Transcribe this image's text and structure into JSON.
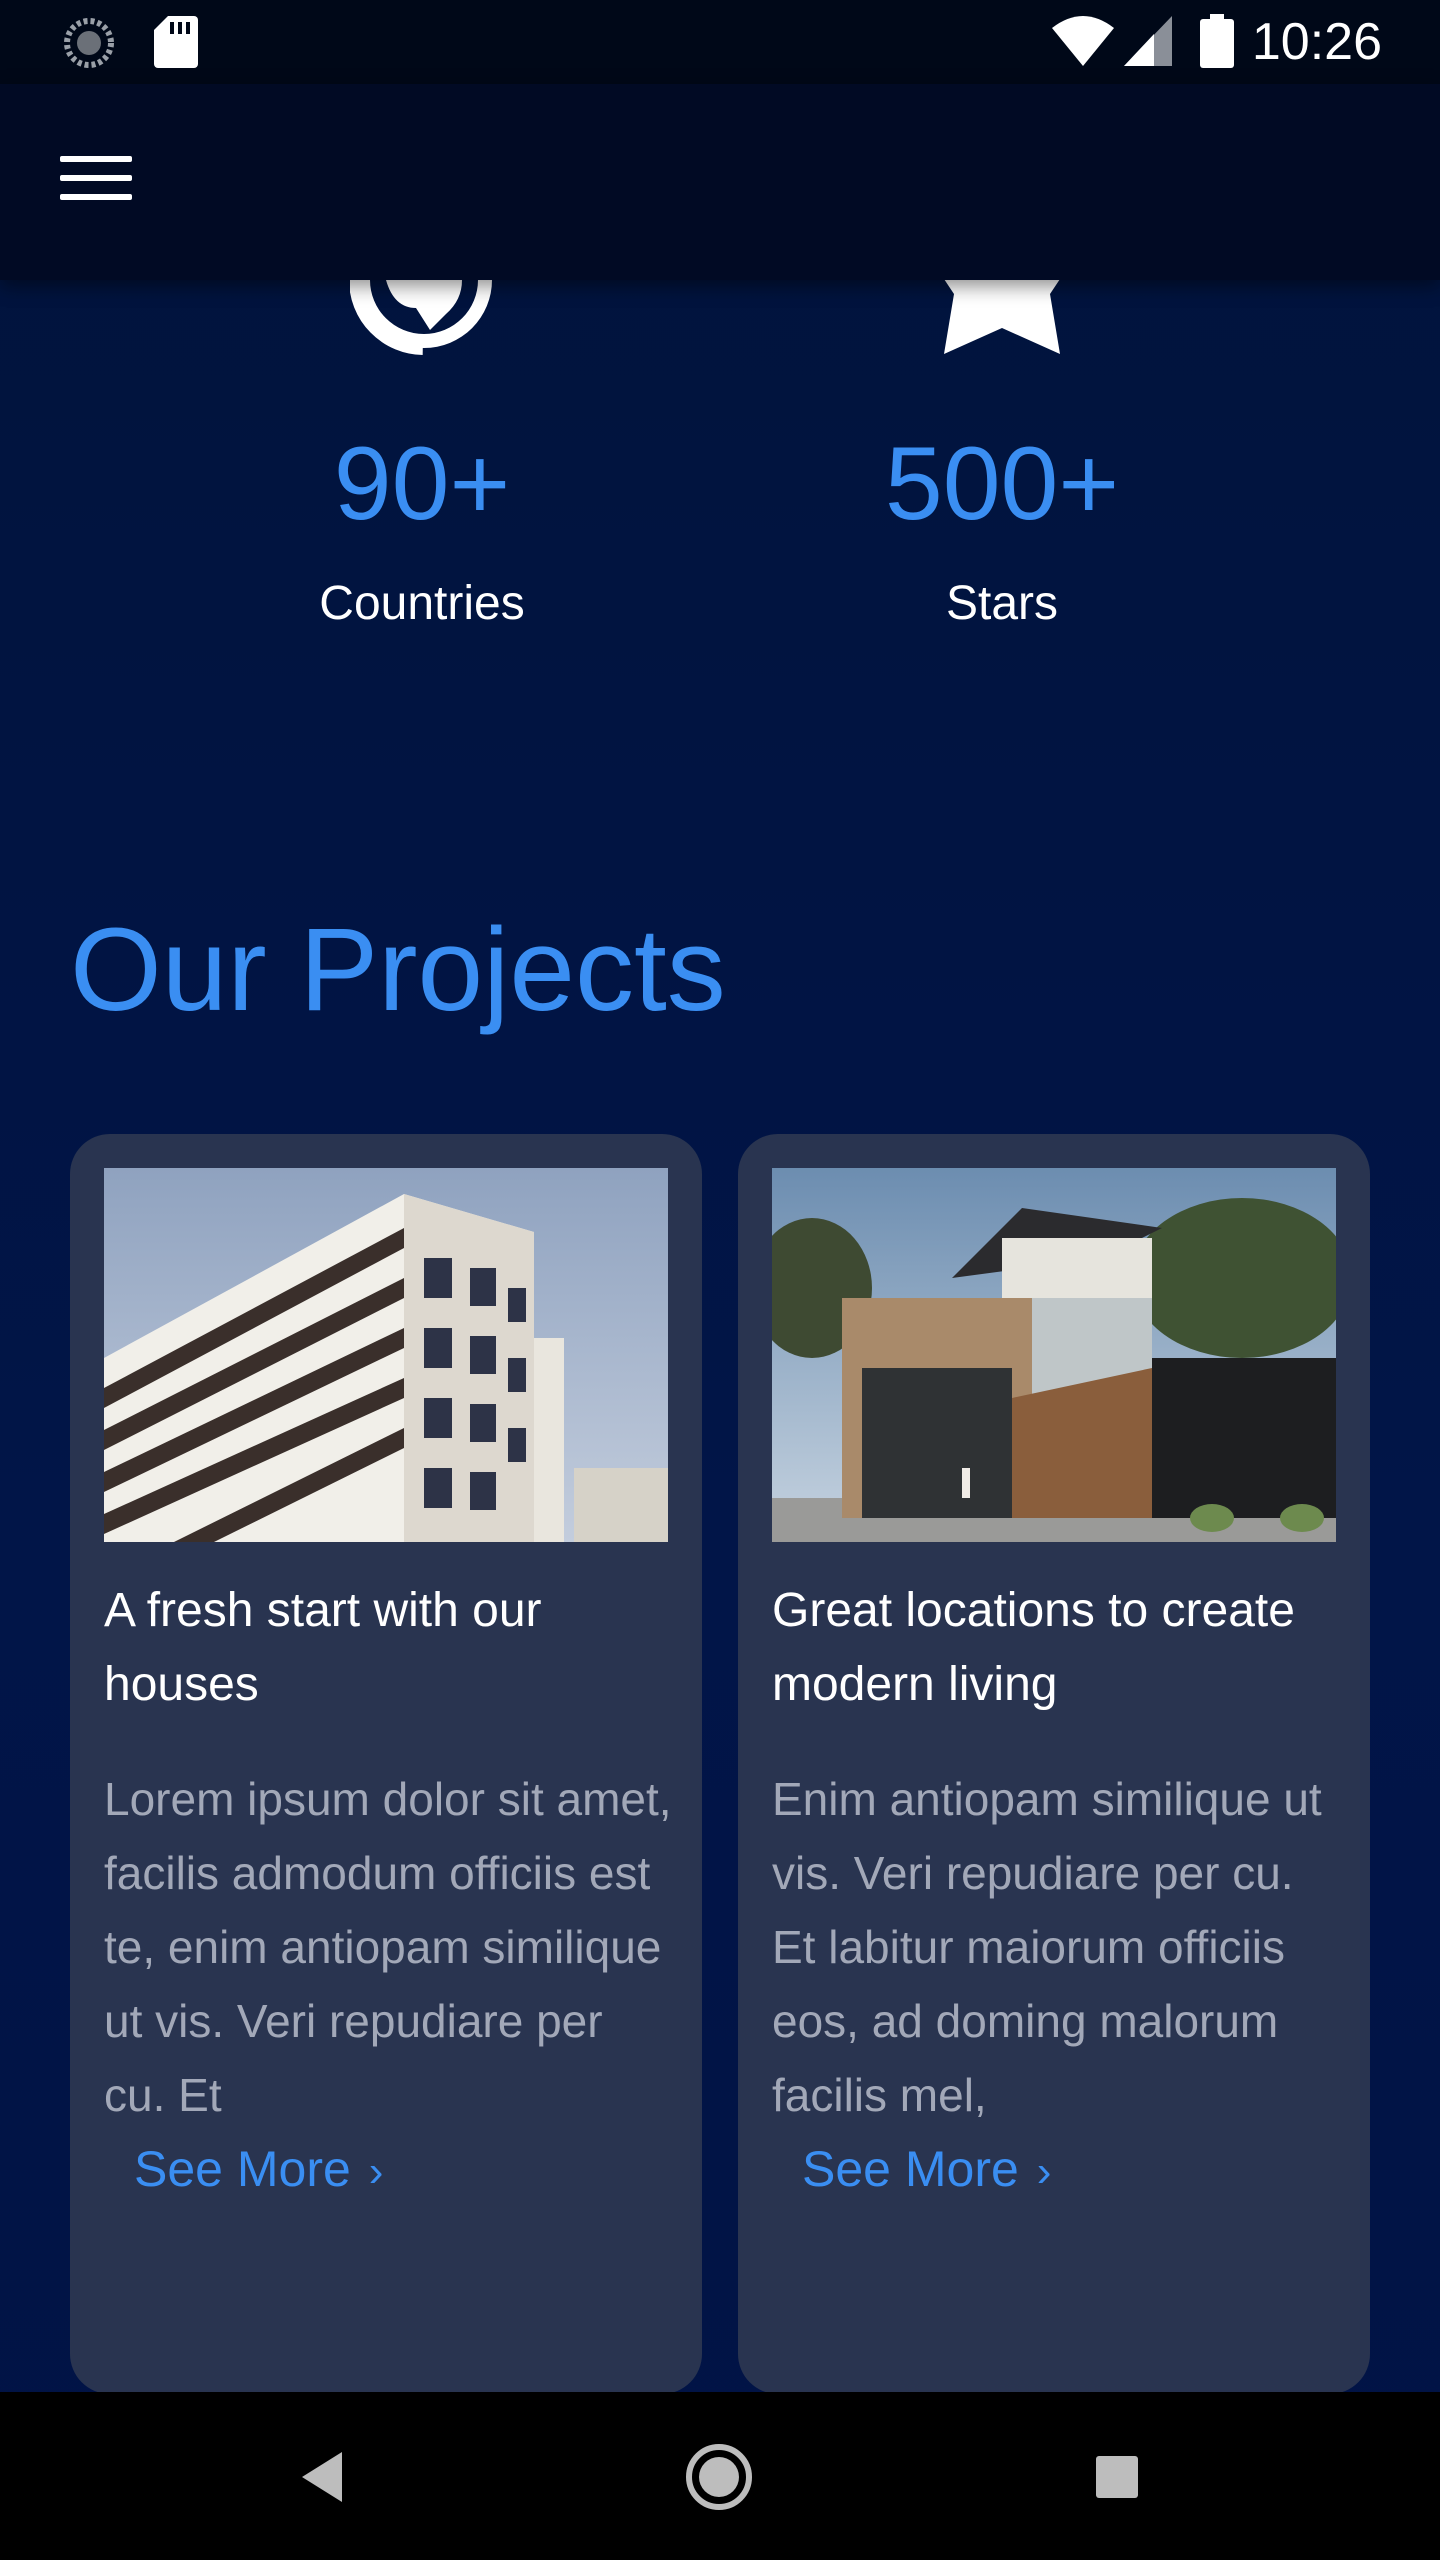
{
  "status_bar": {
    "time": "10:26",
    "icons": [
      "loading-icon",
      "sd-card-icon",
      "wifi-icon",
      "cellular-signal-icon",
      "battery-icon"
    ]
  },
  "app_bar": {
    "menu_icon": "hamburger-menu-icon"
  },
  "stats": [
    {
      "icon": "globe-icon",
      "value": "90+",
      "label": "Countries"
    },
    {
      "icon": "star-icon",
      "value": "500+",
      "label": "Stars"
    }
  ],
  "projects": {
    "title": "Our Projects",
    "cards": [
      {
        "image": "apartment-building-image",
        "title": "A fresh start with our houses",
        "body": "Lorem ipsum dolor sit amet, facilis admodum officiis est te, enim antiopam similique ut vis. Veri repudiare per cu. Et",
        "link": "See More",
        "link_icon": "chevron-right-icon"
      },
      {
        "image": "modern-house-image",
        "title": "Great locations to create modern living",
        "body": "Enim antiopam similique ut vis. Veri repudiare per cu. Et labitur maiorum officiis eos, ad doming malorum facilis mel,",
        "link": "See More",
        "link_icon": "chevron-right-icon"
      }
    ]
  },
  "nav_bar": {
    "buttons": [
      "back-icon",
      "home-icon",
      "recents-icon"
    ]
  },
  "colors": {
    "background": "#011345",
    "accent": "#3a8ef2",
    "card": "#293450",
    "body_text": "#a2a8b8"
  }
}
